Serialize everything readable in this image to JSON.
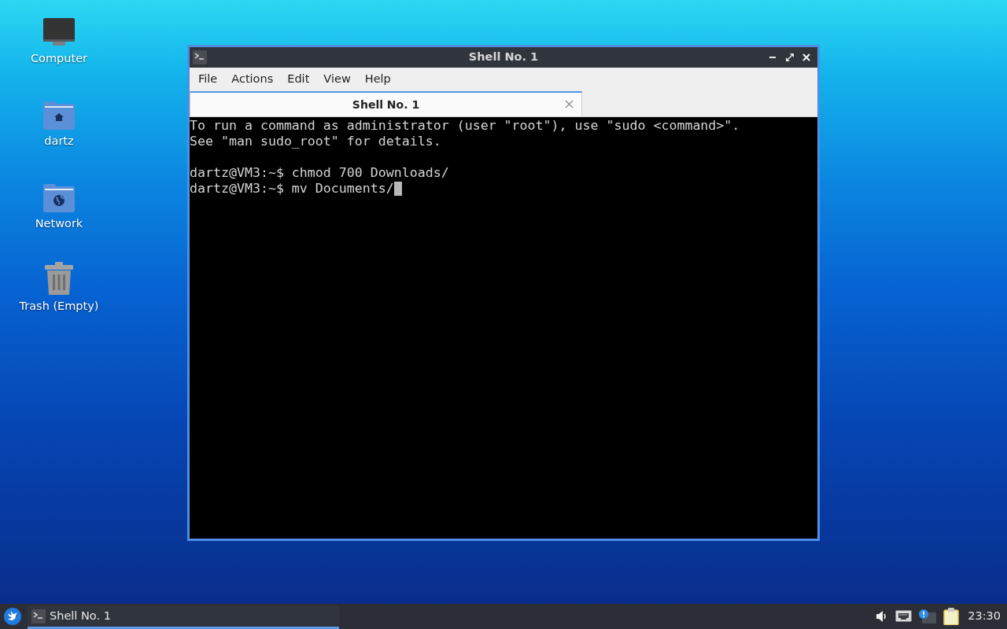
{
  "desktop_icons": [
    {
      "label": "Computer",
      "kind": "computer"
    },
    {
      "label": "dartz",
      "kind": "home"
    },
    {
      "label": "Network",
      "kind": "network"
    },
    {
      "label": "Trash (Empty)",
      "kind": "trash"
    }
  ],
  "window": {
    "title": "Shell No. 1",
    "menu": [
      "File",
      "Actions",
      "Edit",
      "View",
      "Help"
    ],
    "tabs": [
      {
        "label": "Shell No. 1",
        "selected": true
      }
    ],
    "terminal": {
      "blocks": [
        [
          "To run a command as administrator (user \"root\"), use \"sudo <command>\".",
          "See \"man sudo_root\" for details."
        ],
        [
          "dartz@VM3:~$ chmod 700 Downloads/",
          "dartz@VM3:~$ mv Documents/"
        ]
      ],
      "cursor": true
    }
  },
  "taskbar": {
    "tasks": [
      {
        "label": "Shell No. 1",
        "selected": true
      }
    ],
    "clock": "23:30"
  }
}
